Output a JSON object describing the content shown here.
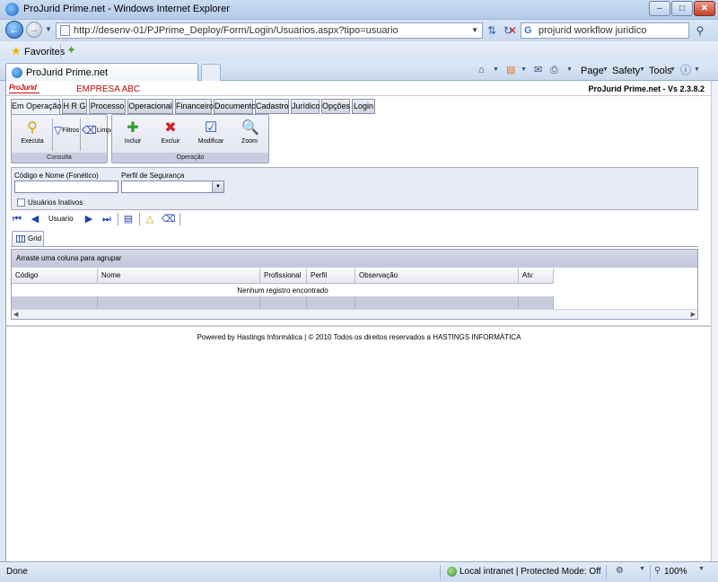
{
  "browser": {
    "title": "ProJurid Prime.net - Windows Internet Explorer",
    "url": "http://desenv-01/PJPrime_Deploy/Form/Login/Usuarios.aspx?tipo=usuario",
    "search_text": "projurid workflow juridico",
    "favorites_label": "Favorites",
    "tab_label": "ProJurid Prime.net",
    "commands": {
      "page": "Page",
      "safety": "Safety",
      "tools": "Tools"
    },
    "status": {
      "left": "Done",
      "zone": "Local intranet | Protected Mode: Off",
      "zoom": "100%"
    }
  },
  "app": {
    "brand": "ProJurid",
    "company": "EMPRESA ABC",
    "version": "ProJurid Prime.net - Vs 2.3.8.2",
    "menu_tabs": [
      "Em Operação",
      "H R G",
      "Processo",
      "Operacional",
      "Financeiro",
      "Documento",
      "Cadastro",
      "Jurídico",
      "Opções",
      "Login"
    ],
    "ribbon": {
      "consulta": {
        "label": "Consulta",
        "executa": "Executa",
        "filtros": "Filtros",
        "limpa": "Limpa"
      },
      "operacao": {
        "label": "Operação",
        "incluir": "Incluir",
        "excluir": "Excluir",
        "modificar": "Modificar",
        "zoom": "Zoom"
      }
    },
    "filters": {
      "codigo_nome_label": "Código e Nome (Fonético)",
      "codigo_nome_value": "",
      "perfil_label": "Perfil de Segurança",
      "perfil_value": "",
      "inativos_label": "Usuários Inativos",
      "inativos_checked": false
    },
    "record_nav": {
      "label": "Usuario"
    },
    "grid": {
      "tab_label": "Grid",
      "group_hint": "Arraste uma coluna para agrupar",
      "columns": [
        "Código",
        "Nome",
        "Profissional",
        "Perfil",
        "Observação",
        "Atv"
      ],
      "empty_text": "Nenhum registro encontrado"
    },
    "footer": "Powered by Hastings Informática | © 2010 Todos os direitos reservados a HASTINGS INFORMÁTICA"
  }
}
